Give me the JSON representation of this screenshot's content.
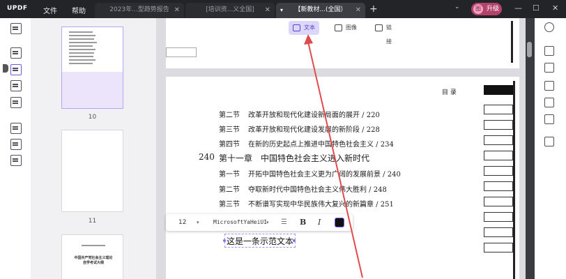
{
  "window": {
    "logo": "UPDF",
    "menu": [
      "文件",
      "帮助"
    ],
    "tabs": [
      {
        "label": "2023年...型趋势报告",
        "active": false
      },
      {
        "label": "[培训资...义全国]",
        "active": false
      },
      {
        "label": "【新教材...(全国）",
        "active": true
      }
    ],
    "upgrade_label": "升级",
    "upgrade_avatar": "图"
  },
  "thumbnails": {
    "pages": [
      {
        "number": "10",
        "selected": true
      },
      {
        "number": "11",
        "selected": false
      }
    ],
    "bottom_thumb_title": "中国共产党社会主义理论自学考试大纲"
  },
  "mode_tabs": [
    {
      "label": "文本",
      "active": true,
      "icon": "text-box-icon"
    },
    {
      "label": "图像",
      "active": false,
      "icon": "image-icon"
    },
    {
      "label": "链接",
      "active": false,
      "icon": "link-icon"
    }
  ],
  "document": {
    "toc_heading": "目  录",
    "entries": [
      {
        "label": "第二节",
        "text": "改革开放和现代化建设新局面的展开 / 220"
      },
      {
        "label": "第三节",
        "text": "改革开放和现代化建设发展的新阶段 / 228"
      },
      {
        "label": "第四节",
        "text": "在新的历史起点上推进中国特色社会主义 / 234"
      },
      {
        "label": "第十一章",
        "text": "中国特色社会主义进入新时代",
        "page": "240"
      },
      {
        "label": "第一节",
        "text": "开拓中国特色社会主义更为广阔的发展前景 / 240"
      },
      {
        "label": "第二节",
        "text": "夺取新时代中国特色社会主义伟大胜利 / 248"
      },
      {
        "label": "第三节",
        "text": "不断谱写实现中华民族伟大复兴的新篇章 / 251"
      }
    ]
  },
  "text_toolbar": {
    "font_size": "12",
    "font_name": "MicrosoftYaHeiUI",
    "bold_label": "B",
    "italic_label": "I"
  },
  "sample_text": "这是一条示范文本",
  "colors": {
    "accent": "#6a5cd8",
    "arrow": "#e14a4a",
    "upgrade": "#b4436c"
  }
}
